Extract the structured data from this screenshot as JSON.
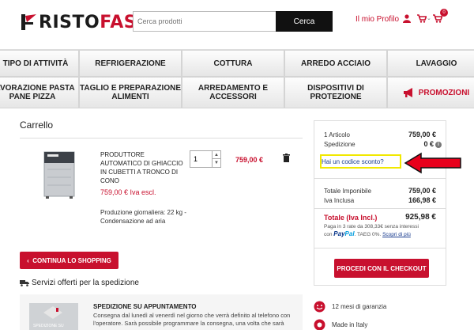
{
  "header": {
    "logo_prefix": "RISTO",
    "logo_accent": "FAST",
    "search_placeholder": "Cerca prodotti",
    "search_button": "Cerca",
    "profile_label": "Il mio Profilo",
    "cart_count": "0"
  },
  "nav": {
    "row1": [
      "TIPO DI ATTIVITÀ",
      "REFRIGERAZIONE",
      "COTTURA",
      "ARREDO ACCIAIO",
      "LAVAGGIO"
    ],
    "row2": [
      "LAVORAZIONE PASTA PANE PIZZA",
      "TAGLIO E PREPARAZIONE ALIMENTI",
      "ARREDAMENTO E ACCESSORI",
      "DISPOSITIVI DI PROTEZIONE"
    ],
    "promo": "PROMOZIONI"
  },
  "cart": {
    "title": "Carrello",
    "product": {
      "name": "PRODUTTORE AUTOMATICO DI GHIACCIO IN CUBETTI A TRONCO DI CONO",
      "price": "759,00 € Iva escl.",
      "spec": "Produzione giornaliera: 22 kg - Condensazione ad aria",
      "quantity": "1",
      "line_total": "759,00 €"
    },
    "continue_button": "CONTINUA LO SHOPPING",
    "services_label": "Servizi offerti per la spedizione",
    "shipping": {
      "title": "SPEDIZIONE SU APPUNTAMENTO",
      "text": "Consegna dal lunedì al venerdì nel giorno che verrà definito al telefono con l'operatore. Sarà possibile programmare la consegna, una volta che sarà",
      "image_caption": "SPEDIZIONE SU"
    }
  },
  "summary": {
    "items_label": "1 Articolo",
    "items_value": "759,00 €",
    "shipping_label": "Spedizione",
    "shipping_value": "0 €",
    "coupon_link": "Hai un codice sconto?",
    "taxable_label": "Totale Imponibile",
    "taxable_value": "759,00 €",
    "vat_label": "Iva Inclusa",
    "vat_value": "166,98 €",
    "total_label": "Totale (Iva Incl.)",
    "total_value": "925,98 €",
    "paypal_line1": "Paga in 3 rate da 308,33€ senza interessi",
    "paypal_with": "con",
    "paypal_pay": "Pay",
    "paypal_pal": "Pal",
    "paypal_taeg": ". TAEG 0%.",
    "paypal_more": "Scopri di più",
    "checkout_button": "PROCEDI CON IL CHECKOUT"
  },
  "badges": {
    "guarantee": "12 mesi di garanzia",
    "made_in": "Made in Italy"
  },
  "colors": {
    "brand": "#c8102e",
    "highlight": "#f1e800",
    "link": "#1a3d8f"
  }
}
